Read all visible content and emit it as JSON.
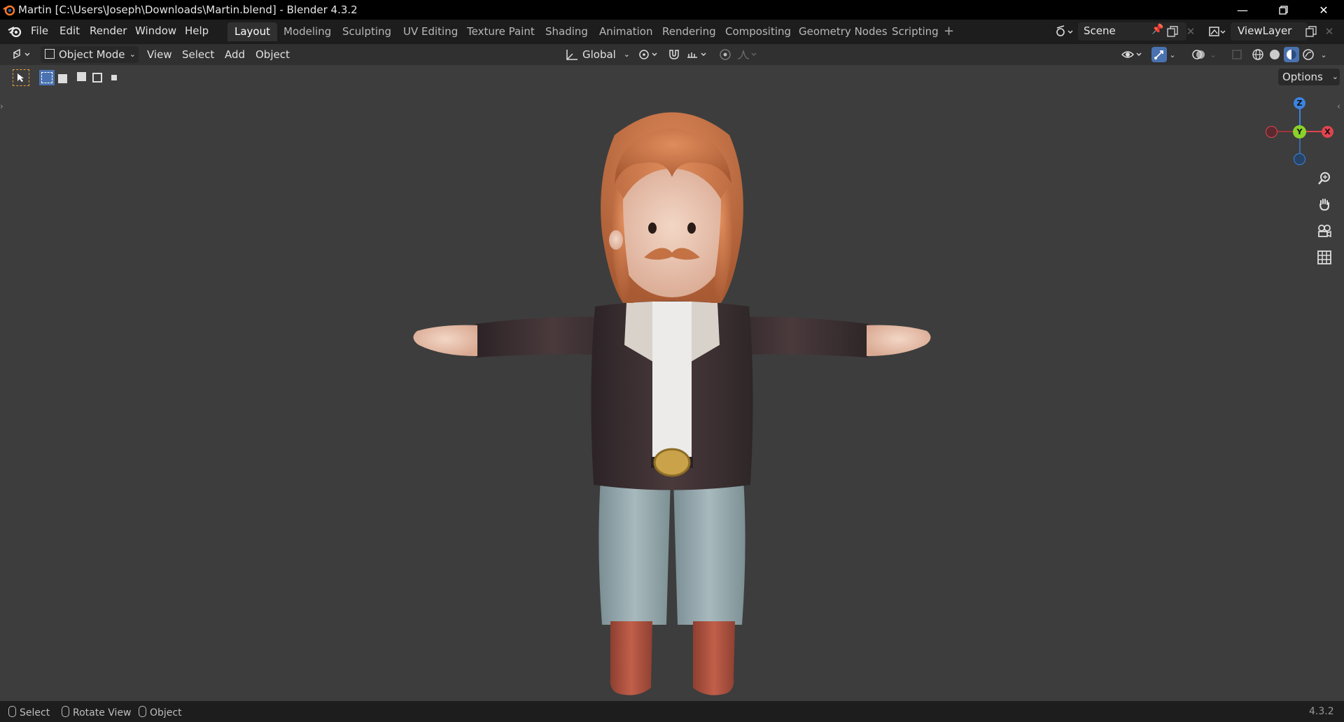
{
  "window": {
    "title": "Martin [C:\\Users\\Joseph\\Downloads\\Martin.blend] - Blender 4.3.2",
    "minimize_icon": "minimize-icon",
    "restore_icon": "restore-icon",
    "close_icon": "close-icon"
  },
  "menu": {
    "file": "File",
    "edit": "Edit",
    "render": "Render",
    "window": "Window",
    "help": "Help"
  },
  "workspaces": [
    "Layout",
    "Modeling",
    "Sculpting",
    "UV Editing",
    "Texture Paint",
    "Shading",
    "Animation",
    "Rendering",
    "Compositing",
    "Geometry Nodes",
    "Scripting"
  ],
  "active_workspace": "Layout",
  "scene": {
    "name": "Scene",
    "view_layer": "ViewLayer"
  },
  "header": {
    "mode": "Object Mode",
    "view": "View",
    "select": "Select",
    "add": "Add",
    "object": "Object",
    "orientation": "Global",
    "options": "Options"
  },
  "gizmo": {
    "z": "Z",
    "y": "Y",
    "x": "X"
  },
  "statusbar": {
    "select": "Select",
    "rotate_view": "Rotate View",
    "object": "Object",
    "version": "4.3.2"
  },
  "colors": {
    "accent": "#4a72b0",
    "axis_x": "#e0444f",
    "axis_y": "#8bd12b",
    "axis_z": "#3b83e0"
  }
}
